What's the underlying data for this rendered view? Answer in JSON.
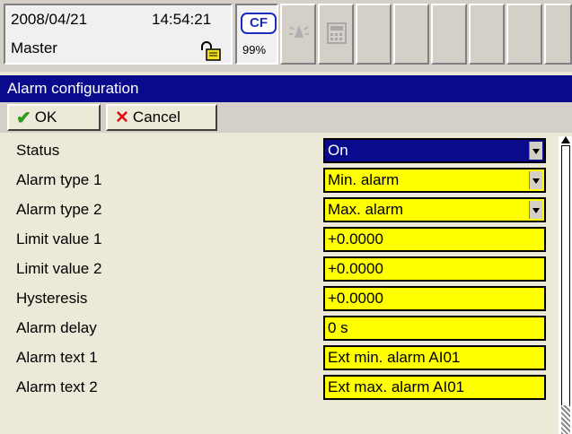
{
  "status_bar": {
    "date": "2008/04/21",
    "time": "14:54:21",
    "user": "Master",
    "cf_label": "CF",
    "cf_percent": "99%",
    "icons": [
      "lock-icon",
      "alarm-bell-icon",
      "calculator-icon"
    ]
  },
  "window_title": "Alarm configuration",
  "toolbar": {
    "ok_label": "OK",
    "cancel_label": "Cancel"
  },
  "form": {
    "rows": [
      {
        "label": "Status",
        "value": "On",
        "type": "select"
      },
      {
        "label": "Alarm type 1",
        "value": "Min. alarm",
        "type": "select"
      },
      {
        "label": "Alarm type 2",
        "value": "Max. alarm",
        "type": "select"
      },
      {
        "label": "Limit value 1",
        "value": "+0.0000",
        "type": "text"
      },
      {
        "label": "Limit value 2",
        "value": "+0.0000",
        "type": "text"
      },
      {
        "label": "Hysteresis",
        "value": "+0.0000",
        "type": "text"
      },
      {
        "label": "Alarm delay",
        "value": "0 s",
        "type": "text"
      },
      {
        "label": "Alarm text 1",
        "value": "Ext min. alarm AI01",
        "type": "text"
      },
      {
        "label": "Alarm text 2",
        "value": "Ext max. alarm AI01",
        "type": "text"
      }
    ]
  },
  "colors": {
    "header_bg": "#0a0a8c",
    "field_bg": "#ffff00",
    "panel_bg": "#ece9d8"
  }
}
